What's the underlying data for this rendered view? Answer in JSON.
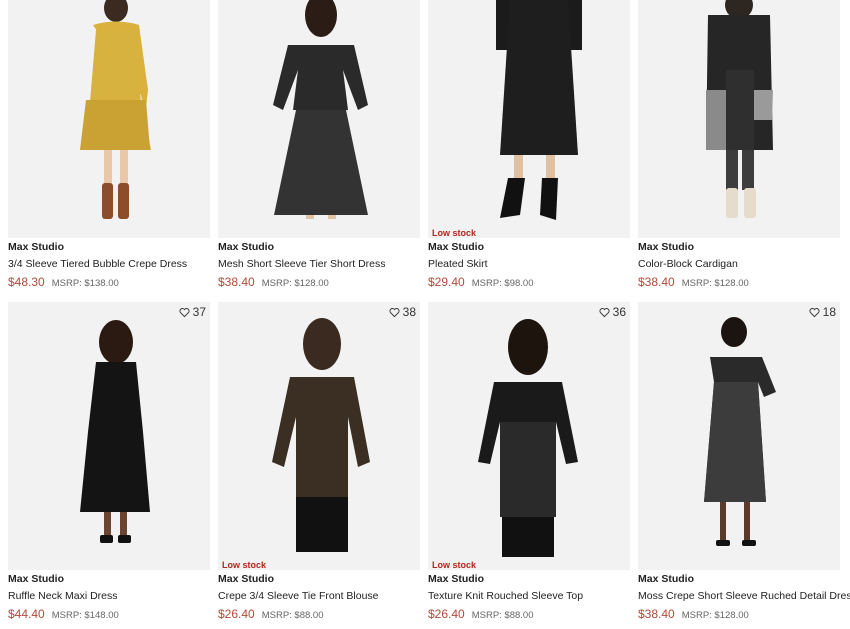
{
  "products": [
    {
      "brand": "Max Studio",
      "name": "3/4 Sleeve Tiered Bubble Crepe Dress",
      "price": "$48.30",
      "msrp": "MSRP: $138.00",
      "badge": "",
      "favorites": ""
    },
    {
      "brand": "Max Studio",
      "name": "Mesh Short Sleeve Tier Short Dress",
      "price": "$38.40",
      "msrp": "MSRP: $128.00",
      "badge": "",
      "favorites": ""
    },
    {
      "brand": "Max Studio",
      "name": "Pleated Skirt",
      "price": "$29.40",
      "msrp": "MSRP: $98.00",
      "badge": "Low stock",
      "favorites": ""
    },
    {
      "brand": "Max Studio",
      "name": "Color-Block Cardigan",
      "price": "$38.40",
      "msrp": "MSRP: $128.00",
      "badge": "",
      "favorites": ""
    },
    {
      "brand": "Max Studio",
      "name": "Ruffle Neck Maxi Dress",
      "price": "$44.40",
      "msrp": "MSRP: $148.00",
      "badge": "",
      "favorites": "37"
    },
    {
      "brand": "Max Studio",
      "name": "Crepe 3/4 Sleeve Tie Front Blouse",
      "price": "$26.40",
      "msrp": "MSRP: $88.00",
      "badge": "Low stock",
      "favorites": "38"
    },
    {
      "brand": "Max Studio",
      "name": "Texture Knit Rouched Sleeve Top",
      "price": "$26.40",
      "msrp": "MSRP: $88.00",
      "badge": "Low stock",
      "favorites": "36"
    },
    {
      "brand": "Max Studio",
      "name": "Moss Crepe Short Sleeve Ruched Detail Dress",
      "price": "$38.40",
      "msrp": "MSRP: $128.00",
      "badge": "",
      "favorites": "18"
    }
  ],
  "icons": {
    "favorite": "heart-outline-icon"
  },
  "colors": {
    "price": "#b04a3a",
    "badge": "#b3261e",
    "image_bg": "#f2f2f2"
  }
}
